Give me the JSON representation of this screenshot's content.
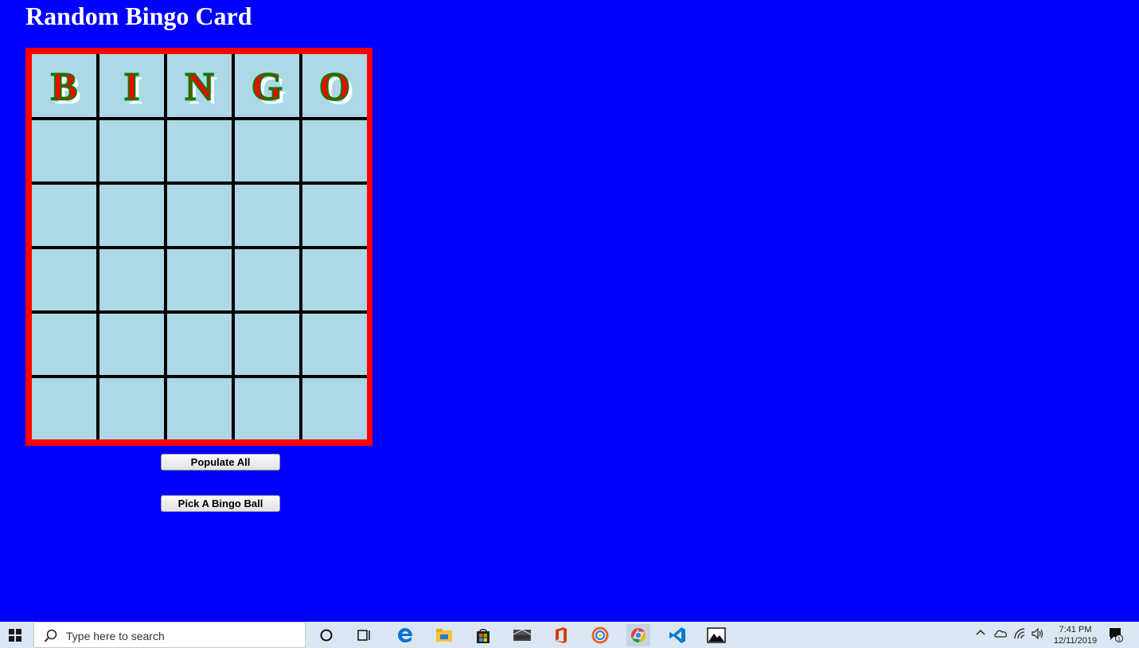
{
  "page": {
    "title": "Random Bingo Card"
  },
  "card": {
    "headers": [
      "B",
      "I",
      "N",
      "G",
      "O"
    ],
    "rows": [
      [
        "",
        "",
        "",
        "",
        ""
      ],
      [
        "",
        "",
        "",
        "",
        ""
      ],
      [
        "",
        "",
        "",
        "",
        ""
      ],
      [
        "",
        "",
        "",
        "",
        ""
      ],
      [
        "",
        "",
        "",
        "",
        ""
      ]
    ]
  },
  "buttons": {
    "populate_label": "Populate All",
    "pick_label": "Pick A Bingo Ball"
  },
  "taskbar": {
    "search_placeholder": "Type here to search",
    "pinned_icons": [
      "cortana-icon",
      "task-view-icon",
      "edge-icon",
      "file-explorer-icon",
      "store-icon",
      "mail-icon",
      "office-icon",
      "photos-app-icon",
      "chrome-icon",
      "vscode-icon",
      "photos-icon"
    ],
    "clock_time": "7:41 PM",
    "clock_date": "12/11/2019",
    "notification_count": "1"
  },
  "colors": {
    "background": "#0000ff",
    "card_border": "#ff0000",
    "cell": "#add8e6",
    "header_letter": "#ff0000",
    "header_outline": "#008000"
  }
}
